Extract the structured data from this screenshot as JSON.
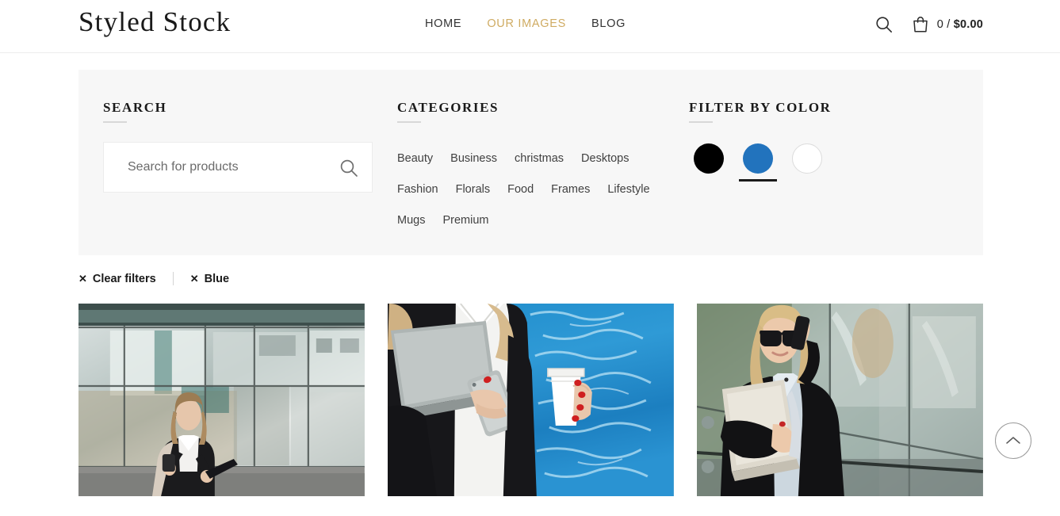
{
  "header": {
    "logo": "Styled Stock",
    "nav": [
      {
        "label": "HOME",
        "active": false
      },
      {
        "label": "OUR IMAGES",
        "active": true
      },
      {
        "label": "BLOG",
        "active": false
      }
    ],
    "cart_count": "0",
    "cart_separator": " / ",
    "cart_total": "$0.00",
    "accent_color": "#cfab62"
  },
  "filters": {
    "search": {
      "heading": "SEARCH",
      "placeholder": "Search for products",
      "value": ""
    },
    "categories": {
      "heading": "CATEGORIES",
      "items": [
        "Beauty",
        "Business",
        "christmas",
        "Desktops",
        "Fashion",
        "Florals",
        "Food",
        "Frames",
        "Lifestyle",
        "Mugs",
        "Premium"
      ]
    },
    "colors": {
      "heading": "FILTER BY COLOR",
      "swatches": [
        {
          "name": "Black",
          "hex": "#000000",
          "selected": false,
          "bordered": false
        },
        {
          "name": "Blue",
          "hex": "#2273bd",
          "selected": true,
          "bordered": false
        },
        {
          "name": "White",
          "hex": "#ffffff",
          "selected": false,
          "bordered": true
        }
      ]
    }
  },
  "active_filters": {
    "clear_label": "Clear filters",
    "chips": [
      "Blue"
    ],
    "close_glyph": "✕"
  },
  "products": [
    {
      "alt": "Businesswoman with phone walking past glass office building"
    },
    {
      "alt": "Woman holding laptop, smartphone and coffee cup beside blue water"
    },
    {
      "alt": "Blonde woman in sunglasses on phone holding laptop by glass wall"
    }
  ],
  "scroll_top": {
    "label": "Back to top"
  }
}
